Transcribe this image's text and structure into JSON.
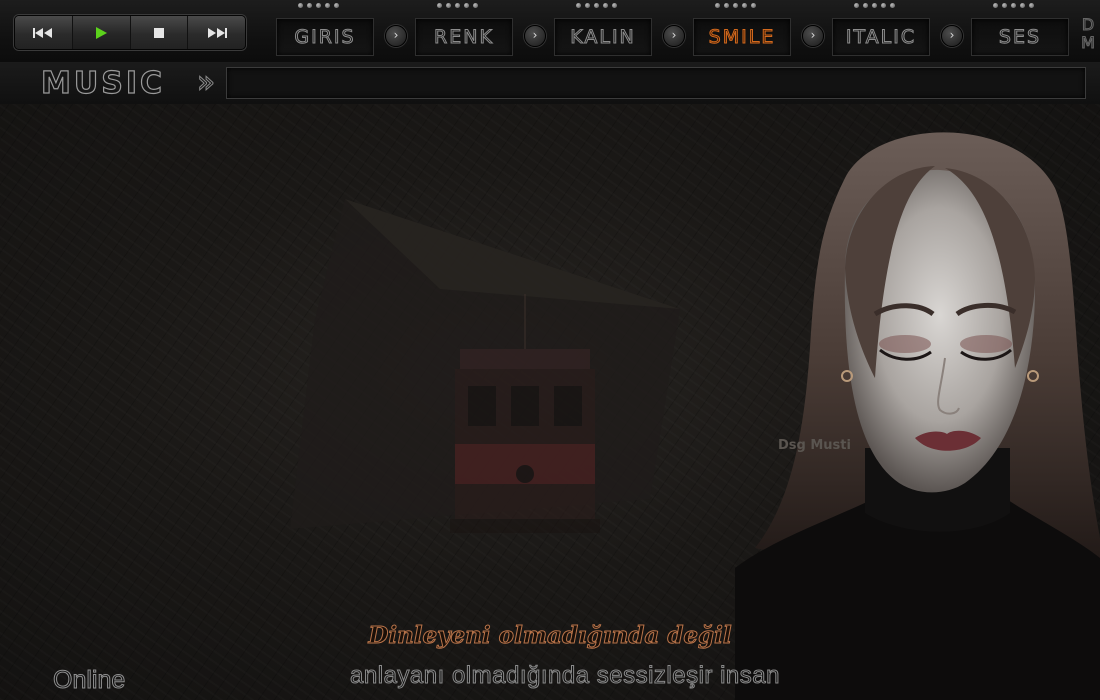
{
  "transport": {
    "buttons": [
      {
        "name": "previous-button",
        "icon": "skip-back-icon"
      },
      {
        "name": "play-button",
        "icon": "play-icon",
        "color": "#5cd21c"
      },
      {
        "name": "stop-button",
        "icon": "stop-icon"
      },
      {
        "name": "next-button",
        "icon": "skip-forward-icon"
      }
    ]
  },
  "tabs": [
    {
      "label": "GIRIS"
    },
    {
      "label": "RENK"
    },
    {
      "label": "KALIN"
    },
    {
      "label": "SMILE",
      "highlight": true,
      "color": "#d3691d"
    },
    {
      "label": "ITALIC"
    },
    {
      "label": "SES"
    }
  ],
  "tab_arrow_glyph": "›",
  "corner_letters": "D M",
  "music_bar": {
    "label": "MUSIC",
    "arrows": "»"
  },
  "stage": {
    "watermark": "Dsg Musti",
    "quote_line1": "Dinleyeni olmadığında değil",
    "quote_line2": "anlayanı olmadığında sessizleşir insan",
    "status": "Online"
  }
}
